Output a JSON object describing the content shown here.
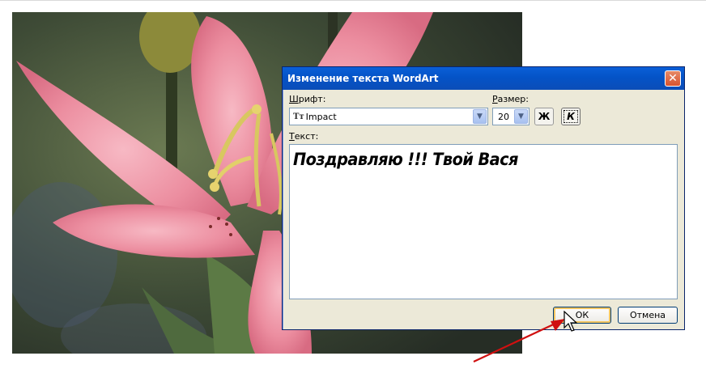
{
  "dialog": {
    "title": "Изменение текста WordArt",
    "close_symbol": "✕",
    "font_label": "Шрифт:",
    "font_label_hotkey": "Ш",
    "font_label_rest": "рифт:",
    "font_value": "Impact",
    "font_icon": "truetype-font-icon",
    "size_label_hotkey": "Р",
    "size_label_rest": "азмер:",
    "size_value": "20",
    "bold_label": "Ж",
    "italic_label": "К",
    "text_label_hotkey": "Т",
    "text_label_rest": "екст:",
    "text_value": "Поздравляю !!! Твой Вася",
    "ok_label": "ОК",
    "cancel_label": "Отмена"
  },
  "colors": {
    "titlebar": "#0453c7",
    "window_bg": "#ece9d8",
    "arrow": "#d01010"
  }
}
